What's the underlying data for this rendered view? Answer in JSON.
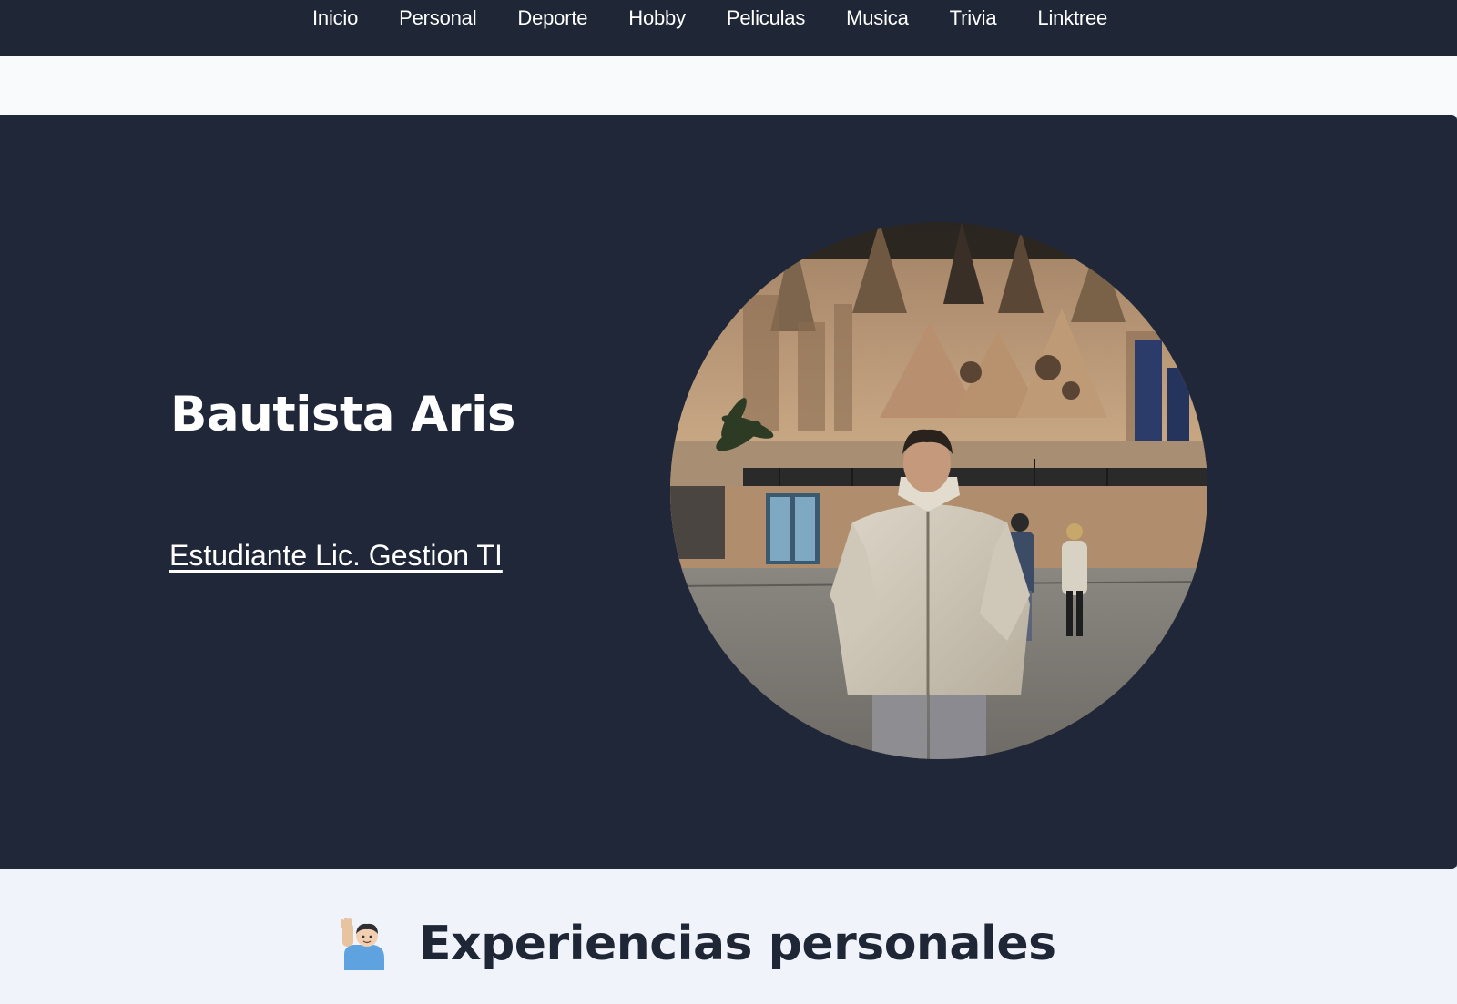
{
  "nav": {
    "items": [
      "Inicio",
      "Personal",
      "Deporte",
      "Hobby",
      "Peliculas",
      "Musica",
      "Trivia",
      "Linktree"
    ]
  },
  "hero": {
    "name": "Bautista Aris",
    "role": "Estudiante Lic. Gestion TI",
    "photo_alt": "Foto de perfil"
  },
  "section": {
    "emoji": "person-raising-hand-icon",
    "title": "Experiencias personales"
  },
  "colors": {
    "nav_bg": "#1f2737",
    "hero_bg": "#1f2739",
    "page_bg": "#f8fafc",
    "title_color": "#1f2737"
  }
}
